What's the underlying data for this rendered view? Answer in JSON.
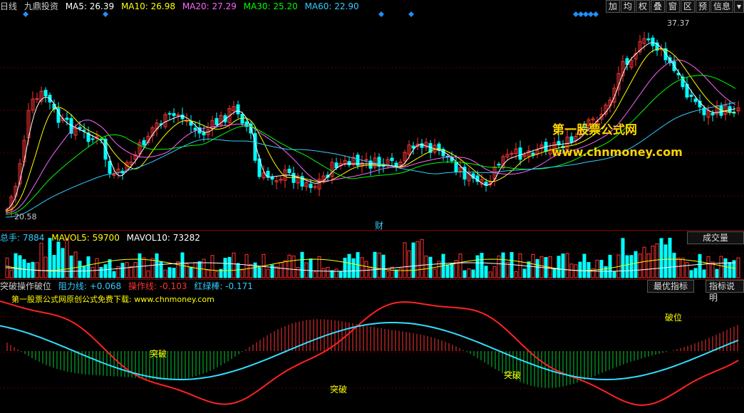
{
  "main_header": {
    "period": "日线",
    "name": "九鼎投资",
    "ma": [
      {
        "label": "MA5: 26.39",
        "color": "#ffffff"
      },
      {
        "label": "MA10: 26.98",
        "color": "#ffff00"
      },
      {
        "label": "MA20: 27.29",
        "color": "#ff66ff"
      },
      {
        "label": "MA30: 25.20",
        "color": "#00ff00"
      },
      {
        "label": "MA60: 22.90",
        "color": "#33ccff"
      }
    ]
  },
  "toolbar": {
    "buttons": [
      "加",
      "均",
      "权",
      "叠",
      "窗",
      "区",
      "预",
      "信息"
    ],
    "more": "▾"
  },
  "price": {
    "high_label": "37.37",
    "low_label": "20.58",
    "finance_marker": "财",
    "watermark_title": "第一股票公式网",
    "watermark_url": "www.chnmoney.com"
  },
  "volume_header": {
    "total": "总手: 7884",
    "mavol5": "MAVOL5: 59700",
    "mavol10": "MAVOL10: 73282",
    "tab": "成交量"
  },
  "indicator_header": {
    "name": "突破操作破位",
    "resist": "阻力线: +0.068",
    "operate": "操作线: -0.103",
    "redgreen": "红绿棒: -0.171",
    "btn_best": "最优指标",
    "btn_desc": "指标说明"
  },
  "indicator": {
    "subtitle": "第一股票公式网原创公式免费下载: www.chnmoney.com",
    "labels": [
      {
        "text": "突破"
      },
      {
        "text": "突破"
      },
      {
        "text": "突破"
      },
      {
        "text": "破位"
      }
    ]
  },
  "colors": {
    "up": "#ff3333",
    "down": "#00ffff",
    "separator": "#8b0000",
    "ma5": "#ffffff",
    "ma10": "#ffff00",
    "ma20": "#ff66ff",
    "ma30": "#00ff00",
    "ma60": "#33ccff"
  }
}
